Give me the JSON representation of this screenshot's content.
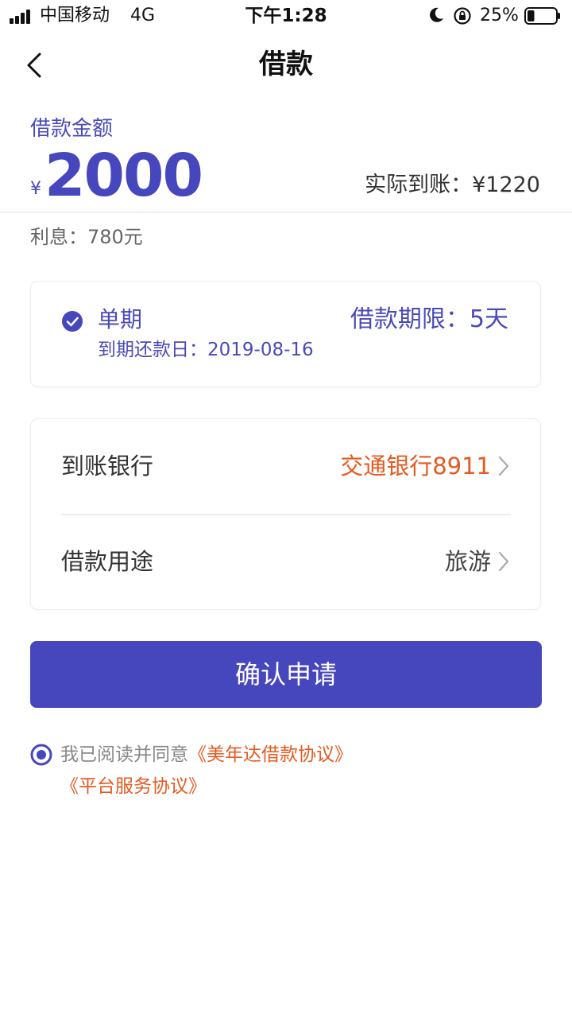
{
  "status_bar": {
    "carrier": "中国移动",
    "network": "4G",
    "time": "下午1:28",
    "battery_percent": "25%",
    "battery_level": 0.25,
    "icons": [
      "signal-icon",
      "moon-icon",
      "rotation-lock-icon",
      "battery-icon"
    ]
  },
  "nav": {
    "title": "借款",
    "back_icon": "chevron-left-icon"
  },
  "amount": {
    "label": "借款金额",
    "currency": "¥",
    "value": "2000",
    "actual_received": "实际到账：¥1220",
    "interest": "利息：780元"
  },
  "term": {
    "type": "单期",
    "due_date": "到期还款日：2019-08-16",
    "limit": "借款期限：5天",
    "selected": true
  },
  "options": {
    "bank_label": "到账银行",
    "bank_value": "交通银行8911",
    "purpose_label": "借款用途",
    "purpose_value": "旅游"
  },
  "confirm_button": "确认申请",
  "agreement": {
    "prefix": "我已阅读并同意",
    "link1": "《美年达借款协议》",
    "link2": "《平台服务协议》",
    "checked": true
  },
  "colors": {
    "primary": "#4646bd",
    "accent_orange": "#e55a20",
    "text": "#333333",
    "muted": "#888888"
  }
}
